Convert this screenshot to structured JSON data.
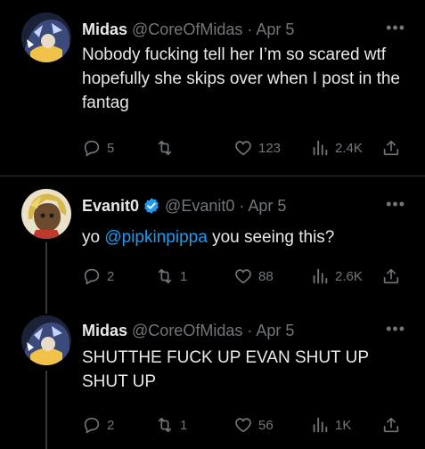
{
  "tweets": [
    {
      "name": "Midas",
      "handle": "@CoreOfMidas",
      "sep": "·",
      "date": "Apr 5",
      "more": "•••",
      "text": "Nobody fucking tell her I’m so scared wtf hopefully she skips over when I post in the fantag",
      "replies": "5",
      "retweets": "",
      "likes": "123",
      "views": "2.4K"
    },
    {
      "name": "Evanit0",
      "handle": "@Evanit0",
      "sep": "·",
      "date": "Apr 5",
      "more": "•••",
      "text_prefix": "yo",
      "mention": "@pipkinpippa",
      "text_suffix": "you seeing this?",
      "replies": "2",
      "retweets": "1",
      "likes": "88",
      "views": "2.6K"
    },
    {
      "name": "Midas",
      "handle": "@CoreOfMidas",
      "sep": "·",
      "date": "Apr 5",
      "more": "•••",
      "text": "SHUTTHE FUCK UP EVAN SHUT UP SHUT UP",
      "replies": "2",
      "retweets": "1",
      "likes": "56",
      "views": "1K"
    }
  ],
  "colors": {
    "background": "#000000",
    "text": "#e7e9ea",
    "muted": "#71767b",
    "accent": "#1d9bf0",
    "divider": "#2f3336"
  },
  "icons": [
    "reply-icon",
    "retweet-icon",
    "like-icon",
    "views-icon",
    "share-icon",
    "verified-badge-icon",
    "more-icon"
  ]
}
